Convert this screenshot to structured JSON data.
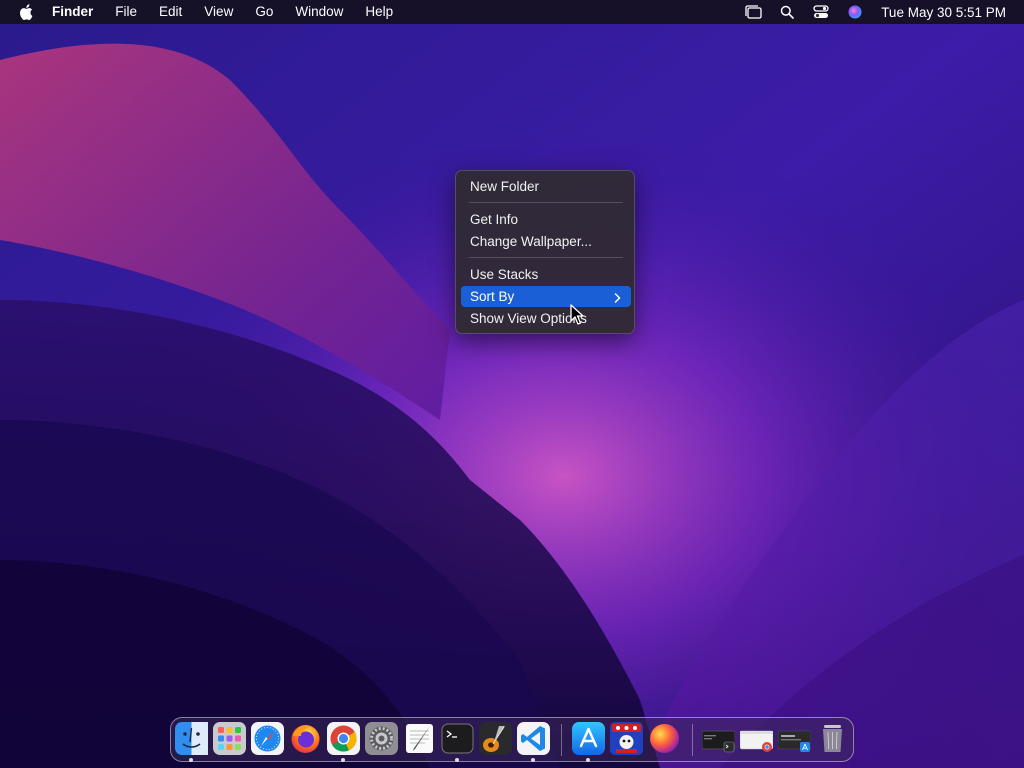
{
  "menubar": {
    "app_name": "Finder",
    "menus": [
      "File",
      "Edit",
      "View",
      "Go",
      "Window",
      "Help"
    ],
    "datetime": "Tue May 30  5:51 PM"
  },
  "context_menu": {
    "items": [
      "New Folder",
      "Get Info",
      "Change Wallpaper...",
      "Use Stacks",
      "Sort By",
      "Show View Options"
    ],
    "active_item": "Sort By"
  },
  "dock": {
    "apps": [
      "finder-icon",
      "launchpad-icon",
      "safari-icon",
      "firefox-icon",
      "chrome-icon",
      "system-settings-icon",
      "textedit-icon",
      "terminal-icon",
      "garageband-icon",
      "vscode-icon",
      "app-store-icon",
      "game-icon",
      "color-picker-icon"
    ],
    "minimized": [
      "terminal-thumbnail-icon",
      "chrome-thumbnail-icon",
      "app-store-thumbnail-icon"
    ],
    "trash": "trash-icon"
  },
  "colors": {
    "highlight": "#1b5fd6",
    "menubar_bg": "#14101e"
  }
}
